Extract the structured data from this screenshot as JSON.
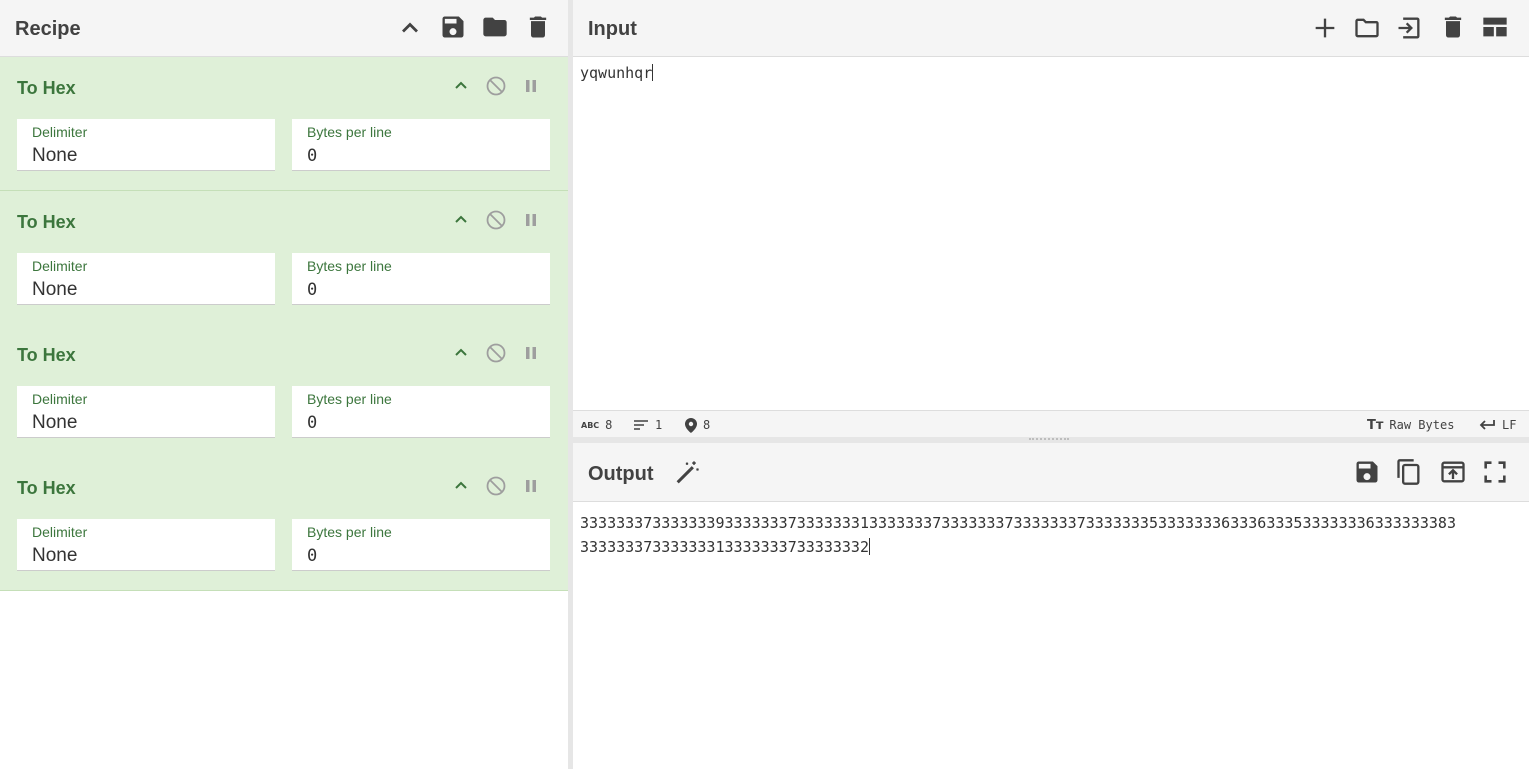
{
  "recipe": {
    "title": "Recipe",
    "operations": [
      {
        "name": "To Hex",
        "args": [
          {
            "label": "Delimiter",
            "value": "None"
          },
          {
            "label": "Bytes per line",
            "value": "0"
          }
        ]
      },
      {
        "name": "To Hex",
        "args": [
          {
            "label": "Delimiter",
            "value": "None"
          },
          {
            "label": "Bytes per line",
            "value": "0"
          }
        ]
      },
      {
        "name": "To Hex",
        "args": [
          {
            "label": "Delimiter",
            "value": "None"
          },
          {
            "label": "Bytes per line",
            "value": "0"
          }
        ]
      },
      {
        "name": "To Hex",
        "args": [
          {
            "label": "Delimiter",
            "value": "None"
          },
          {
            "label": "Bytes per line",
            "value": "0"
          }
        ]
      }
    ]
  },
  "input": {
    "title": "Input",
    "text": "yqwunhqr",
    "status": {
      "chars": "8",
      "lines": "1",
      "position": "8",
      "encoding": "Raw Bytes",
      "eol": "LF"
    }
  },
  "output": {
    "title": "Output",
    "text_line1": "3333333733333339333333373333333133333337333333373333333733333335333333363336333533333336333333383",
    "text_line2": "33333337333333313333333733333332"
  },
  "colors": {
    "op_background": "#dff0d8",
    "op_title": "#3c763d",
    "header_bg": "#f5f5f5"
  }
}
